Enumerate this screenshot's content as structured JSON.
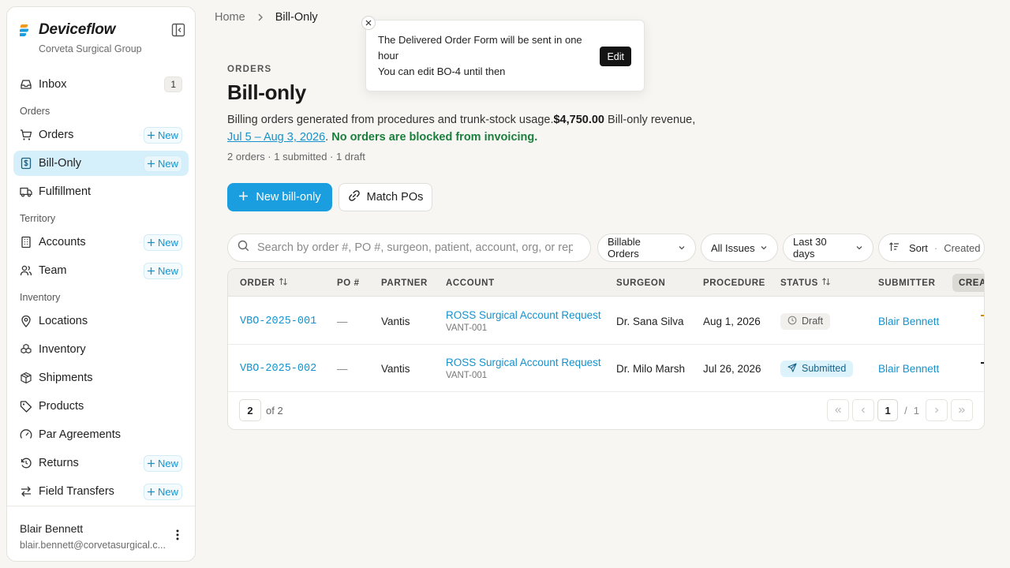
{
  "app": {
    "name": "Deviceflow",
    "org": "Corveta Surgical Group"
  },
  "sidebar": {
    "inbox": {
      "label": "Inbox",
      "count": "1"
    },
    "sections": {
      "orders": "Orders",
      "territory": "Territory",
      "inventory": "Inventory"
    },
    "items": {
      "orders": {
        "label": "Orders",
        "new": "New"
      },
      "bill_only": {
        "label": "Bill-Only",
        "new": "New"
      },
      "fulfillment": {
        "label": "Fulfillment"
      },
      "accounts": {
        "label": "Accounts",
        "new": "New"
      },
      "team": {
        "label": "Team",
        "new": "New"
      },
      "locations": {
        "label": "Locations"
      },
      "inventory": {
        "label": "Inventory"
      },
      "shipments": {
        "label": "Shipments"
      },
      "products": {
        "label": "Products"
      },
      "par_agreements": {
        "label": "Par Agreements"
      },
      "returns": {
        "label": "Returns",
        "new": "New"
      },
      "field_transfers": {
        "label": "Field Transfers",
        "new": "New"
      }
    },
    "user": {
      "name": "Blair Bennett",
      "email": "blair.bennett@corvetasurgical.c..."
    }
  },
  "breadcrumb": {
    "home": "Home",
    "current": "Bill-Only"
  },
  "toast": {
    "line1": "The Delivered Order Form will be sent in one hour",
    "line2": "You can edit BO-4 until then",
    "edit": "Edit"
  },
  "header": {
    "eyebrow": "ORDERS",
    "title": "Bill-only",
    "desc_text": "Billing orders generated from procedures and trunk-stock usage.",
    "revenue": "$4,750.00",
    "revenue_suffix": " Bill-only revenue,",
    "date_range": "Jul 5 – Aug 3, 2026",
    "period": ".",
    "ok_text": "No orders are blocked from invoicing.",
    "counts": "2 orders · 1 submitted · 1 draft"
  },
  "actions": {
    "new_bill_only": "New bill-only",
    "match_pos": "Match POs"
  },
  "filters": {
    "search_placeholder": "Search by order #, PO #, surgeon, patient, account, org, or rep...",
    "billable": "Billable Orders",
    "issues": "All Issues",
    "period": "Last 30 days",
    "sort_label": "Sort",
    "sort_sep": "·",
    "sort_value": "Created"
  },
  "table": {
    "headers": {
      "order": "ORDER",
      "po": "PO #",
      "partner": "PARTNER",
      "account": "ACCOUNT",
      "surgeon": "SURGEON",
      "procedure": "PROCEDURE",
      "status": "STATUS",
      "submitter": "SUBMITTER",
      "created": "CREAT"
    },
    "rows": [
      {
        "order": "VBO-2025-001",
        "po": "—",
        "partner": "Vantis",
        "account": "ROSS Surgical Account Request",
        "account_code": "VANT-001",
        "surgeon": "Dr. Sana Silva",
        "procedure": "Aug 1, 2026",
        "status": "Draft",
        "submitter": "Blair Bennett"
      },
      {
        "order": "VBO-2025-002",
        "po": "—",
        "partner": "Vantis",
        "account": "ROSS Surgical Account Request",
        "account_code": "VANT-001",
        "surgeon": "Dr. Milo Marsh",
        "procedure": "Jul 26, 2026",
        "status": "Submitted",
        "submitter": "Blair Bennett"
      }
    ],
    "footer": {
      "page_size": "2",
      "of_total": "of 2",
      "page": "1",
      "page_sep": "/",
      "page_total": "1"
    }
  },
  "colors": {
    "accent": "#1a9ee0",
    "link": "#1592cc",
    "active_nav": "#d6f0fb",
    "success": "#1a7f3c"
  }
}
